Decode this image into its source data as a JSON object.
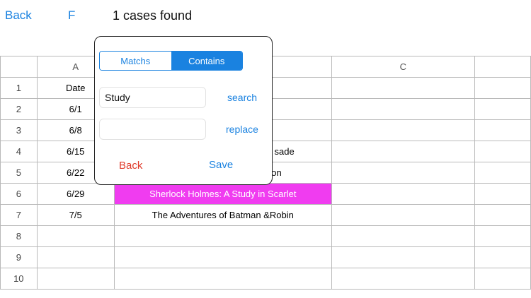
{
  "header": {
    "back_label": "Back",
    "f_label": "F",
    "status": "1 cases found"
  },
  "grid": {
    "columns": [
      "",
      "A",
      "",
      "C",
      ""
    ],
    "rows": [
      {
        "num": "1",
        "a": "Date",
        "b": ""
      },
      {
        "num": "2",
        "a": "6/1",
        "b": ""
      },
      {
        "num": "3",
        "a": "6/8",
        "b": ""
      },
      {
        "num": "4",
        "a": "6/15",
        "b": "sade"
      },
      {
        "num": "5",
        "a": "6/22",
        "b": "on"
      },
      {
        "num": "6",
        "a": "6/29",
        "b": "Sherlock Holmes: A Study in Scarlet"
      },
      {
        "num": "7",
        "a": "7/5",
        "b": "The Adventures of Batman &Robin"
      },
      {
        "num": "8",
        "a": "",
        "b": ""
      },
      {
        "num": "9",
        "a": "",
        "b": ""
      },
      {
        "num": "10",
        "a": "",
        "b": ""
      }
    ],
    "highlight_color": "#f03cf0"
  },
  "popover": {
    "segment_options": [
      "Matchs",
      "Contains"
    ],
    "selected_segment": "Contains",
    "find_value": "Study",
    "replace_value": "",
    "search_label": "search",
    "replace_label": "replace",
    "back_label": "Back",
    "save_label": "Save"
  },
  "colors": {
    "accent": "#1a82e0",
    "destructive": "#e03a2a"
  }
}
